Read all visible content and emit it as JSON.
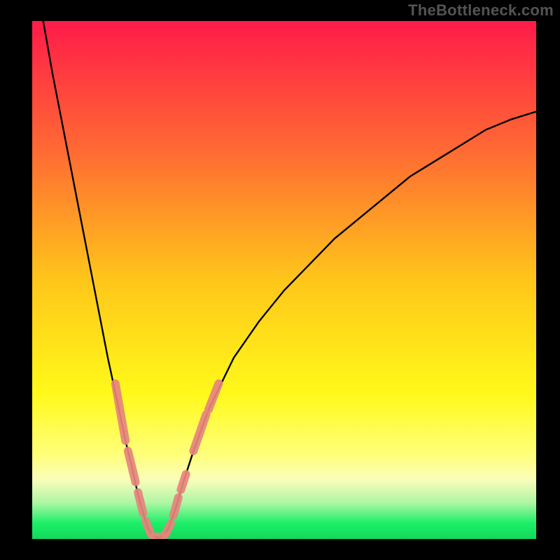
{
  "watermark": "TheBottleneck.com",
  "chart_data": {
    "type": "line",
    "title": "",
    "xlabel": "",
    "ylabel": "",
    "xlim": [
      0,
      100
    ],
    "ylim": [
      0,
      100
    ],
    "grid": false,
    "legend": false,
    "annotations": [],
    "gradient_stops": [
      {
        "offset": 0,
        "color": "#ff1b49"
      },
      {
        "offset": 0.25,
        "color": "#ff6a33"
      },
      {
        "offset": 0.5,
        "color": "#ffc61a"
      },
      {
        "offset": 0.72,
        "color": "#fff91a"
      },
      {
        "offset": 0.84,
        "color": "#ffff7d"
      },
      {
        "offset": 0.885,
        "color": "#fafdba"
      },
      {
        "offset": 0.93,
        "color": "#aef6a4"
      },
      {
        "offset": 0.97,
        "color": "#1bef66"
      },
      {
        "offset": 1,
        "color": "#14d75c"
      }
    ],
    "series": [
      {
        "name": "curve",
        "color": "#000000",
        "points": [
          {
            "x": 2.0,
            "y": 101.0
          },
          {
            "x": 4.0,
            "y": 90.0
          },
          {
            "x": 7.0,
            "y": 75.0
          },
          {
            "x": 10.0,
            "y": 60.0
          },
          {
            "x": 13.0,
            "y": 45.0
          },
          {
            "x": 15.0,
            "y": 35.0
          },
          {
            "x": 17.0,
            "y": 26.0
          },
          {
            "x": 18.5,
            "y": 19.0
          },
          {
            "x": 20.0,
            "y": 13.0
          },
          {
            "x": 21.0,
            "y": 8.5
          },
          {
            "x": 22.0,
            "y": 5.0
          },
          {
            "x": 23.0,
            "y": 2.0
          },
          {
            "x": 24.0,
            "y": 0.6
          },
          {
            "x": 25.0,
            "y": 0.2
          },
          {
            "x": 26.0,
            "y": 0.6
          },
          {
            "x": 27.0,
            "y": 2.0
          },
          {
            "x": 28.5,
            "y": 6.0
          },
          {
            "x": 30.0,
            "y": 11.0
          },
          {
            "x": 32.0,
            "y": 17.0
          },
          {
            "x": 35.0,
            "y": 25.0
          },
          {
            "x": 40.0,
            "y": 35.0
          },
          {
            "x": 45.0,
            "y": 42.0
          },
          {
            "x": 50.0,
            "y": 48.0
          },
          {
            "x": 55.0,
            "y": 53.0
          },
          {
            "x": 60.0,
            "y": 58.0
          },
          {
            "x": 65.0,
            "y": 62.0
          },
          {
            "x": 70.0,
            "y": 66.0
          },
          {
            "x": 75.0,
            "y": 70.0
          },
          {
            "x": 80.0,
            "y": 73.0
          },
          {
            "x": 85.0,
            "y": 76.0
          },
          {
            "x": 90.0,
            "y": 79.0
          },
          {
            "x": 95.0,
            "y": 81.0
          },
          {
            "x": 100.0,
            "y": 82.5
          }
        ]
      },
      {
        "name": "left-scatter",
        "color": "#e8857d",
        "segments": [
          {
            "x1": 16.5,
            "y1": 30,
            "x2": 18.5,
            "y2": 19
          },
          {
            "x1": 19.0,
            "y1": 17,
            "x2": 20.5,
            "y2": 11
          },
          {
            "x1": 21.0,
            "y1": 9,
            "x2": 22.0,
            "y2": 5
          },
          {
            "x1": 22.5,
            "y1": 3.5,
            "x2": 23.5,
            "y2": 1
          },
          {
            "x1": 24.0,
            "y1": 0.4,
            "x2": 26.0,
            "y2": 0.4
          }
        ]
      },
      {
        "name": "right-scatter",
        "color": "#e8857d",
        "segments": [
          {
            "x1": 26.5,
            "y1": 1,
            "x2": 27.5,
            "y2": 3
          },
          {
            "x1": 28.0,
            "y1": 4.5,
            "x2": 29.0,
            "y2": 8
          },
          {
            "x1": 29.5,
            "y1": 9.5,
            "x2": 30.5,
            "y2": 12.5
          },
          {
            "x1": 32.0,
            "y1": 17,
            "x2": 34.5,
            "y2": 24
          },
          {
            "x1": 35.0,
            "y1": 25,
            "x2": 37.0,
            "y2": 30
          }
        ]
      }
    ]
  }
}
